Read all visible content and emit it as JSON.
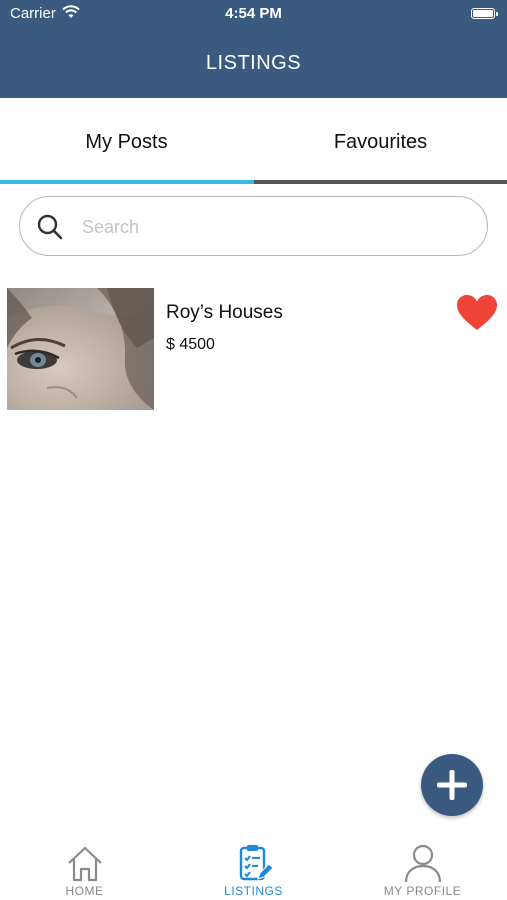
{
  "status_bar": {
    "carrier": "Carrier",
    "time": "4:54 PM"
  },
  "header": {
    "title": "LISTINGS"
  },
  "tabs": [
    {
      "label": "My Posts",
      "active": true
    },
    {
      "label": "Favourites",
      "active": false
    }
  ],
  "search": {
    "placeholder": "Search",
    "value": ""
  },
  "listings": [
    {
      "name": "Roy’s Houses",
      "price": "$ 4500",
      "favourite": true,
      "image": "portrait-photo"
    }
  ],
  "fab": {
    "icon": "plus-icon"
  },
  "bottom_nav": [
    {
      "label": "HOME",
      "icon": "home-icon",
      "active": false
    },
    {
      "label": "LISTINGS",
      "icon": "listings-icon",
      "active": true
    },
    {
      "label": "MY PROFILE",
      "icon": "profile-icon",
      "active": false
    }
  ],
  "colors": {
    "primary": "#3b5a80",
    "tab_active_underline": "#38b8e6",
    "tab_inactive_underline": "#555555",
    "heart": "#f0443a",
    "nav_active": "#1e88d8",
    "nav_inactive": "#8a8a8a"
  }
}
